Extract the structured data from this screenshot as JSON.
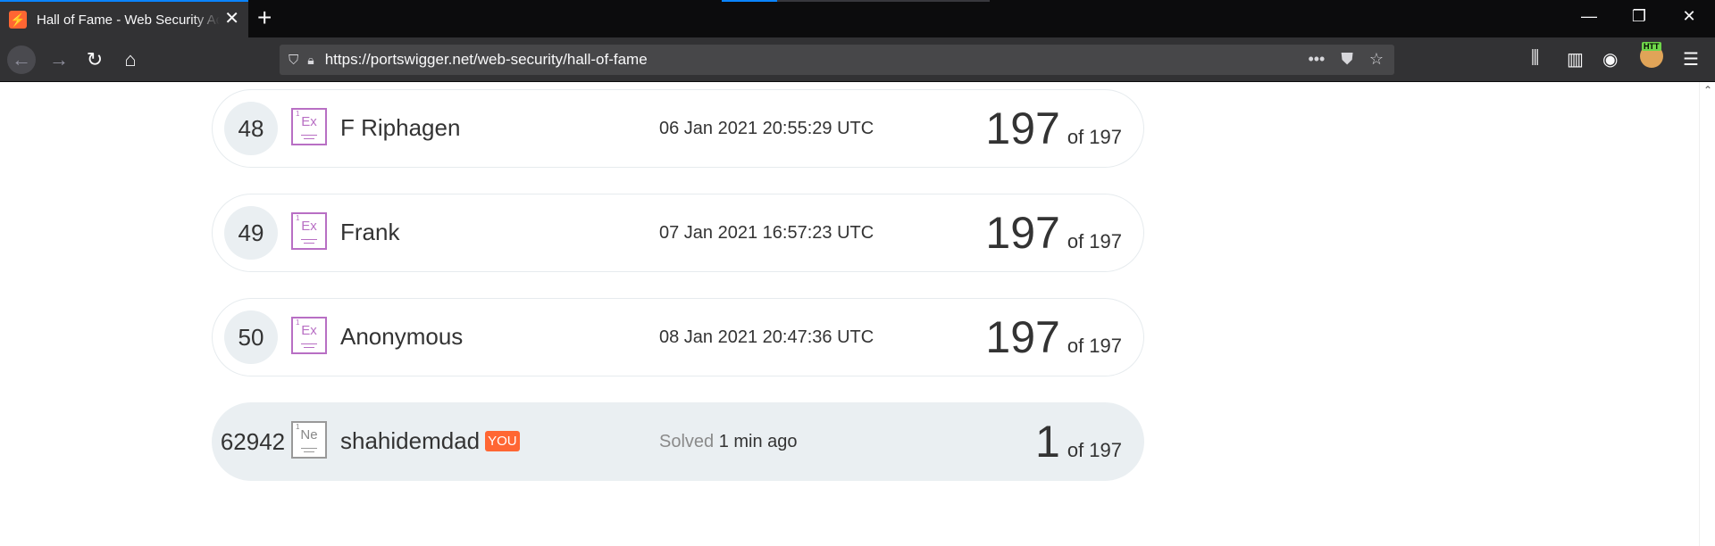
{
  "browser": {
    "tab_title": "Hall of Fame - Web Security Academy",
    "tab_favicon": "⚡",
    "url": "https://portswigger.net/web-security/hall-of-fame",
    "extension_label": "HTT"
  },
  "rows": [
    {
      "rank": "48",
      "level_num": "1",
      "level_symbol": "Ex",
      "name": "F Riphagen",
      "time": "06 Jan 2021 20:55:29 UTC",
      "solved": "197",
      "total": "of 197"
    },
    {
      "rank": "49",
      "level_num": "1",
      "level_symbol": "Ex",
      "name": "Frank",
      "time": "07 Jan 2021 16:57:23 UTC",
      "solved": "197",
      "total": "of 197"
    },
    {
      "rank": "50",
      "level_num": "1",
      "level_symbol": "Ex",
      "name": "Anonymous",
      "time": "08 Jan 2021 20:47:36 UTC",
      "solved": "197",
      "total": "of 197"
    }
  ],
  "current_user": {
    "rank": "62942",
    "level_num": "1",
    "level_symbol": "Ne",
    "name": "shahidemdad",
    "badge": "YOU",
    "time_prefix": "Solved",
    "time_value": "1 min ago",
    "solved": "1",
    "total": "of 197"
  },
  "colors": {
    "accent": "#ff6633",
    "expert_level": "#b86fc4",
    "highlight_row": "#eaeff2"
  }
}
